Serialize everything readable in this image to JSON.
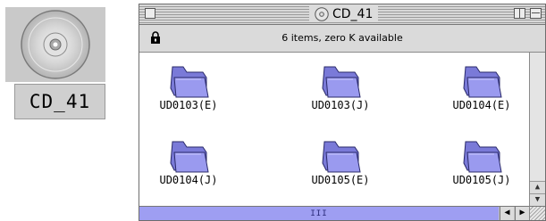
{
  "desktop": {
    "cd_label": "CD_41",
    "cd_icon": "cd-disc-icon"
  },
  "window": {
    "title": "CD_41",
    "title_icon": "cd-disc-icon",
    "info_text": "6 items, zero K available",
    "lock_icon": "lock-icon"
  },
  "items": [
    {
      "label": "UD0103(E)",
      "icon": "folder-icon"
    },
    {
      "label": "UD0103(J)",
      "icon": "folder-icon"
    },
    {
      "label": "UD0104(E)",
      "icon": "folder-icon"
    },
    {
      "label": "UD0104(J)",
      "icon": "folder-icon"
    },
    {
      "label": "UD0105(E)",
      "icon": "folder-icon"
    },
    {
      "label": "UD0105(J)",
      "icon": "folder-icon"
    }
  ],
  "scrollbar": {
    "thumb_glyph": "III",
    "left_arrow": "◀",
    "right_arrow": "▶",
    "up_arrow": "▲",
    "down_arrow": "▼"
  },
  "colors": {
    "scroll_track": "#9e9ef2",
    "folder_fill": "#8f8fe6"
  }
}
